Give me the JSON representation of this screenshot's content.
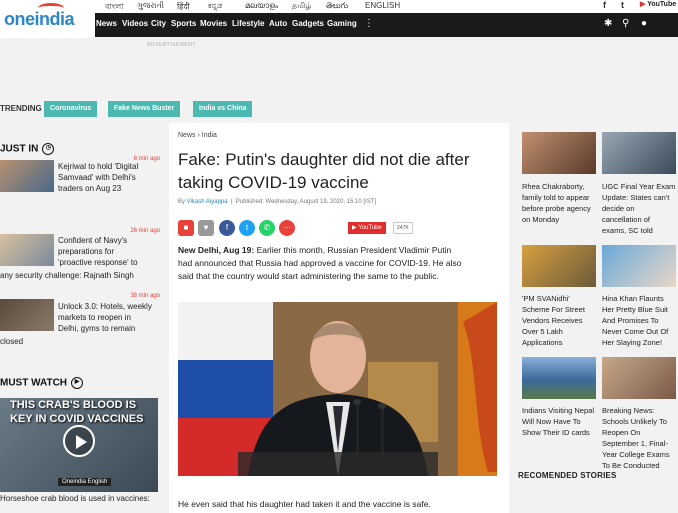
{
  "brand": {
    "logo": "oneindia"
  },
  "languages": [
    "বাংলা",
    "ગુજરાતી",
    "हिंदी",
    "ಕನ್ನಡ",
    "മലയാളം",
    "தமிழ்",
    "తెలుగు",
    "ENGLISH"
  ],
  "social": {
    "facebook": "f",
    "twitter": "t",
    "youtube": "YouTube"
  },
  "nav": [
    "News",
    "Videos",
    "City",
    "Sports",
    "Movies",
    "Lifestyle",
    "Auto",
    "Gadgets",
    "Gaming"
  ],
  "ad_label": "ADVERTISEMENT",
  "trending": {
    "label": "TRENDING",
    "tags": [
      "Coronavirus",
      "Fake News Buster",
      "India vs China"
    ]
  },
  "just_in": {
    "title": "JUST IN",
    "items": [
      {
        "time": "8 min ago",
        "text_lines": [
          "Kejriwal to hold 'Digital",
          "Samvaad' with Delhi's",
          "traders on Aug 23"
        ]
      },
      {
        "time": "26 min ago",
        "text_lines": [
          "Confident of Navy's",
          "preparations for",
          "'proactive response' to"
        ],
        "overflow": "any security challenge: Rajnath Singh"
      },
      {
        "time": "38 min ago",
        "text_lines": [
          "Unlock 3.0: Hotels, weekly",
          "markets to reopen in",
          "Delhi, gyms to remain"
        ],
        "overflow": "closed"
      }
    ]
  },
  "must_watch": {
    "title": "MUST WATCH",
    "video_title": "THIS CRAB'S BLOOD IS KEY IN COVID VACCINES",
    "brand": "Oneindia English",
    "caption": "Horseshoe crab blood is used in vaccines:"
  },
  "article": {
    "breadcrumb": [
      "News",
      "India"
    ],
    "headline": "Fake: Putin's daughter did not die after taking COVID-19 vaccine",
    "author": "Vikash Aiyappa",
    "published": "Published: Wednesday, August 19, 2020, 15:10 [IST]",
    "youtube_label": "YouTube",
    "youtube_count": "247K",
    "lead_dateline": "New Delhi, Aug 19:",
    "lead_lines": [
      "Earlier this month, Russian President Vladimir Putin",
      "had announced that Russia had approved a vaccine for COVID-19. He also",
      "said that the country would start administering the same to the public."
    ],
    "body_line": "He even said that his daughter had taken it and the vaccine is safe."
  },
  "sidebar_cards": [
    {
      "lines": [
        "Rhea Chakraborty,",
        "family told to appear",
        "before probe agency",
        "on Monday"
      ]
    },
    {
      "lines": [
        "UGC Final Year Exam",
        "Update: States can't",
        "decide on",
        "cancellation of",
        "exams, SC told"
      ]
    },
    {
      "lines": [
        "'PM SVANidhi'",
        "Scheme For Street",
        "Vendors Receives",
        "Over 5 Lakh",
        "Applications"
      ]
    },
    {
      "lines": [
        "Hina Khan Flaunts",
        "Her Pretty Blue Suit",
        "And Promises To",
        "Never Come Out Of",
        "Her Slaying Zone!"
      ]
    },
    {
      "lines": [
        "Indians Visiting Nepal",
        "Will Now Have To",
        "Show Their ID cards"
      ]
    },
    {
      "lines": [
        "Breaking News:",
        "Schools Unlikely To",
        "Reopen On",
        "September 1, Final-",
        "Year College Exams",
        "To Be Conducted"
      ]
    }
  ],
  "recommended": "RECOMENDED STORIES",
  "colors": {
    "accent": "#2c87c6",
    "tag": "#4bb9b0",
    "nav_bg": "#1a1a1a",
    "time": "#e8413a"
  }
}
